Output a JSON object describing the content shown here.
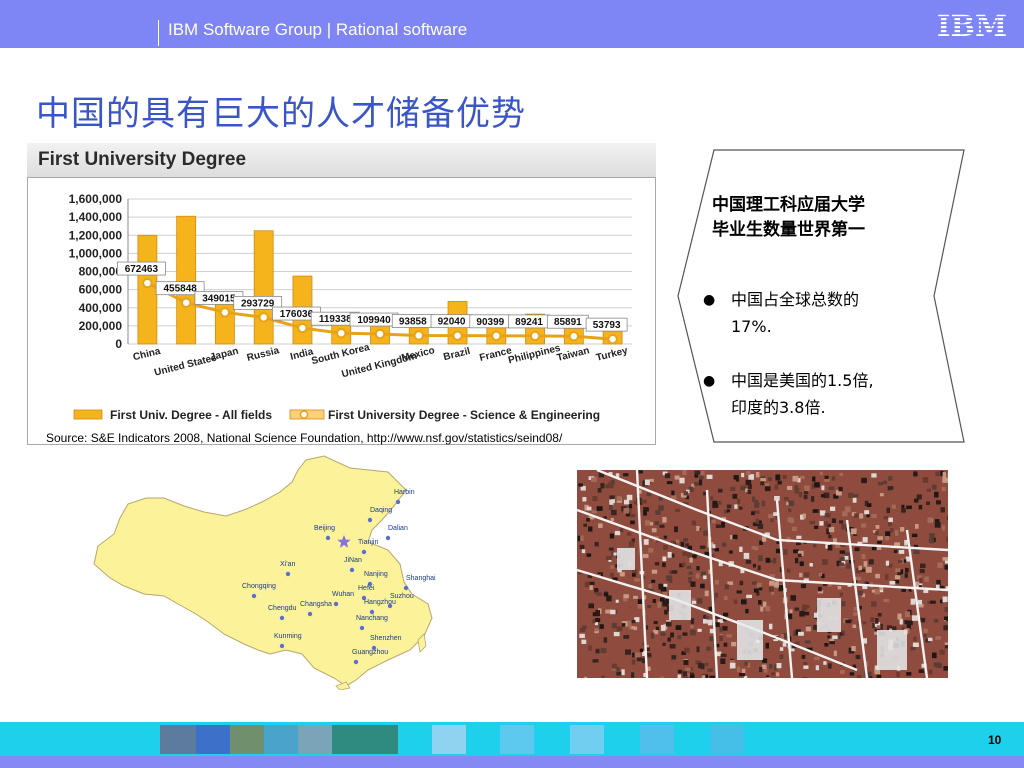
{
  "header": {
    "group_text": "IBM Software Group | Rational software",
    "logo_text": "IBM",
    "brand_color": "#7e85f4"
  },
  "slide": {
    "title": "中国的具有巨大的人才储备优势",
    "page_number": "10",
    "title_color": "#3a55c8"
  },
  "chart_data": {
    "type": "bar",
    "title": "First University Degree",
    "categories": [
      "China",
      "United States",
      "Japan",
      "Russia",
      "India",
      "South Korea",
      "United Kingdom",
      "Mexico",
      "Brazil",
      "France",
      "Philippines",
      "Taiwan",
      "Turkey"
    ],
    "y_ticks": [
      "1,600,000",
      "1,400,000",
      "1,200,000",
      "1,000,000",
      "800,000",
      "600,000",
      "400,000",
      "200,000",
      "0"
    ],
    "ylim": [
      0,
      1600000
    ],
    "series": [
      {
        "name": "First Univ. Degree - All fields",
        "values": [
          1200000,
          1410000,
          560000,
          1250000,
          750000,
          330000,
          330000,
          180000,
          470000,
          260000,
          330000,
          220000,
          150000
        ]
      },
      {
        "name": "First University Degree - Science & Engineering",
        "values": [
          672463,
          455848,
          349015,
          293729,
          176036,
          119338,
          109940,
          93858,
          92040,
          90399,
          89241,
          85891,
          53793
        ]
      }
    ],
    "data_labels": [
      "672463",
      "455848",
      "349015",
      "293729",
      "176036",
      "119338",
      "109940",
      "93858",
      "92040",
      "90399",
      "89241",
      "85891",
      "53793"
    ],
    "grid": true,
    "legend_position": "bottom",
    "colors": {
      "bars": "#f5b31c",
      "line": "#e8a21a",
      "points": "#ffffff"
    }
  },
  "source_text": "Source: S&E Indicators 2008, National Science Foundation, http://www.nsf.gov/statistics/seind08/",
  "note_box": {
    "heading_line1": "中国理工科应届大学",
    "heading_line2": "毕业生数量世界第一",
    "bullets": [
      {
        "line1": "中国占全球总数的",
        "line2": "17%."
      },
      {
        "line1": "中国是美国的1.5倍,",
        "line2": "印度的3.8倍."
      }
    ]
  },
  "map": {
    "cities": [
      "Harbin",
      "Daqing",
      "Beijing",
      "Dalian",
      "Tianjin",
      "Xi'an",
      "JiNan",
      "Nanjing",
      "Shanghai",
      "Chongqing",
      "Hefei",
      "Wuhan",
      "Suzhou",
      "Chengdu",
      "Changsha",
      "Hangzhou",
      "Nanchang",
      "Kunming",
      "Shenzhen",
      "Guangzhou"
    ],
    "colors": {
      "land": "#fcf29a",
      "dots": "#5b6fd0"
    }
  },
  "icons": {
    "bullet": "bullet-disc",
    "logo": "ibm-logo"
  }
}
